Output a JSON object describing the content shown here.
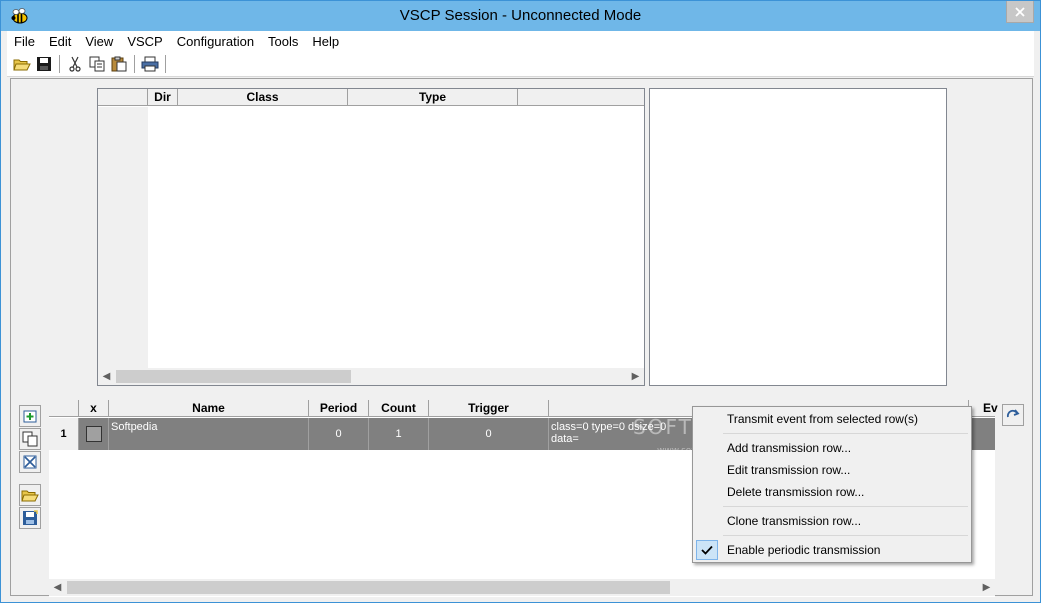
{
  "window": {
    "title": "VSCP Session - Unconnected Mode"
  },
  "menu": [
    "File",
    "Edit",
    "View",
    "VSCP",
    "Configuration",
    "Tools",
    "Help"
  ],
  "toolbar": {
    "icons": [
      "open-folder-icon",
      "save-icon",
      "cut-icon",
      "copy-icon",
      "paste-icon",
      "print-icon"
    ]
  },
  "receive_table": {
    "columns": [
      "Dir",
      "Class",
      "Type"
    ]
  },
  "transmit_table": {
    "columns": [
      "x",
      "Name",
      "Period",
      "Count",
      "Trigger",
      "",
      "Ev"
    ],
    "rows": [
      {
        "index": "1",
        "name": "Softpedia",
        "period": "0",
        "count": "1",
        "trigger": "0",
        "event_line1": "class=0 type=0 dsize=0",
        "event_line2": "data="
      }
    ]
  },
  "context_menu": {
    "items": [
      "Transmit event from selected row(s)",
      "Add transmission row...",
      "Edit transmission row...",
      "Delete transmission row...",
      "Clone transmission row...",
      "Enable periodic transmission"
    ],
    "checked_index": 5
  },
  "watermark": {
    "text": "SOFTPEDIA",
    "sub": "www.softpedia.com"
  },
  "colors": {
    "titlebar": "#6fb7e8",
    "selected_row": "#808080",
    "check_highlight": "#cce4f7"
  }
}
